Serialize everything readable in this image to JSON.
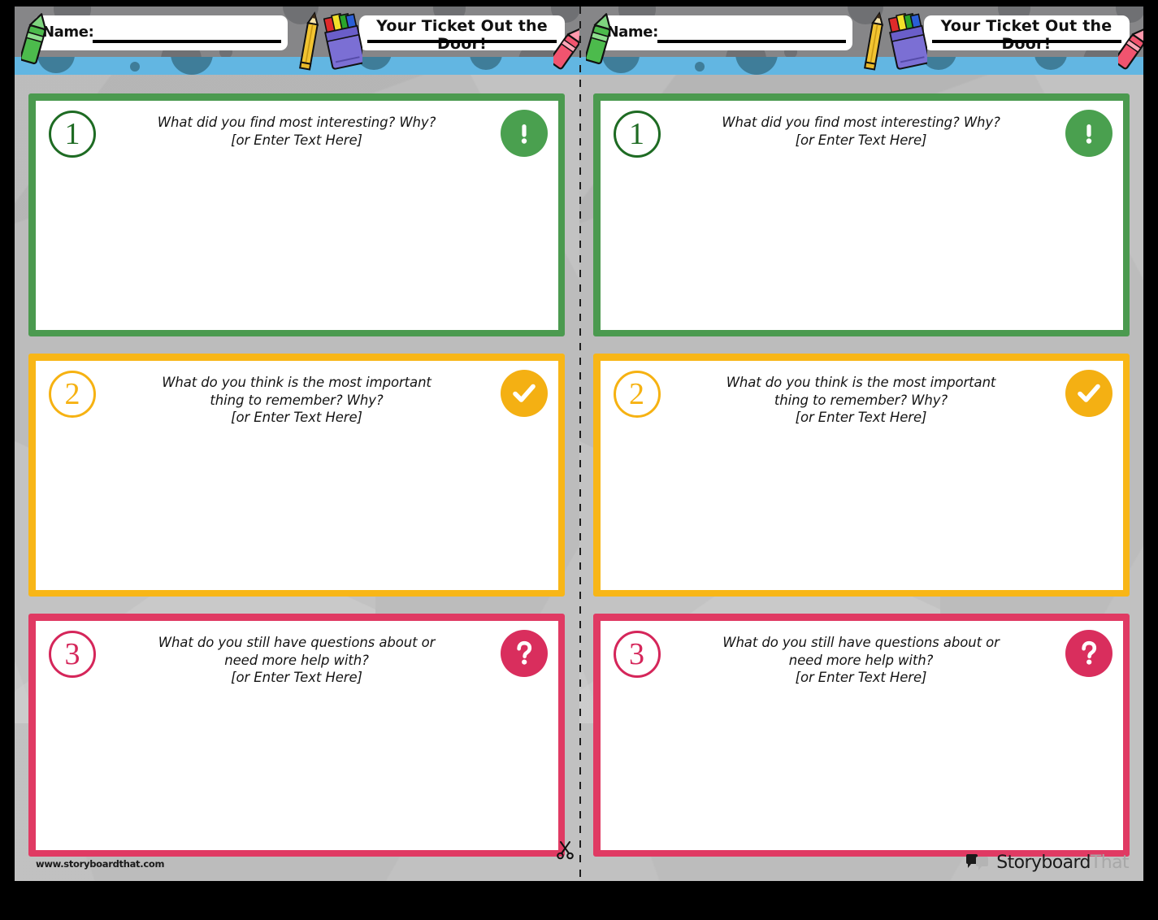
{
  "document": {
    "title": "Your Ticket Out the Door!",
    "type": "exit-ticket-worksheet",
    "pages": 2
  },
  "header": {
    "name_label": "Name:",
    "name_value": "",
    "title_line_1": "Your Ticket Out the",
    "title_line_2": "Door!",
    "title_full": "Your Ticket Out the Door!",
    "decorations": [
      "green-crayon-icon",
      "pencil-icon",
      "crayon-box-icon",
      "pink-crayon-icon"
    ]
  },
  "cards": [
    {
      "number": "1",
      "prompt": "What did you find most interesting? Why?",
      "hint": "[or Enter Text Here]",
      "badge_icon": "exclamation-icon",
      "badge_glyph": "!",
      "color": "#4aa04f",
      "border_color": "#4b9a4f",
      "number_color": "#1e6b23",
      "answer_value": ""
    },
    {
      "number": "2",
      "prompt": "What do you think is the most important thing to remember? Why?",
      "prompt_line_1": "What do you think is the most important",
      "prompt_line_2": "thing to remember? Why?",
      "hint": "[or Enter Text Here]",
      "badge_icon": "checkmark-icon",
      "badge_glyph": "✓",
      "color": "#f4b013",
      "border_color": "#f8b617",
      "number_color": "#f6b212",
      "answer_value": ""
    },
    {
      "number": "3",
      "prompt": "What do you still have questions about or need more help with?",
      "prompt_line_1": "What do you still have questions about or",
      "prompt_line_2": "need more help with?",
      "hint": "[or Enter Text Here]",
      "badge_icon": "question-mark-icon",
      "badge_glyph": "?",
      "color": "#d92e5d",
      "border_color": "#e03a63",
      "number_color": "#d5265a",
      "answer_value": ""
    }
  ],
  "footer": {
    "url": "www.storyboardthat.com",
    "logo_primary": "Storyboard",
    "logo_secondary": "That",
    "logo_icon": "speech-bubbles-icon"
  },
  "cut_line": {
    "icon": "scissors-icon",
    "style": "dashed"
  },
  "colors": {
    "page_background": "#bcbcbc",
    "header_band": "#868688",
    "header_dots": "#6f7073",
    "blue_strip": "#62b6e2",
    "strip_dots": "#3f7d99",
    "card_background": "#ffffff",
    "outer_background": "#000000"
  }
}
